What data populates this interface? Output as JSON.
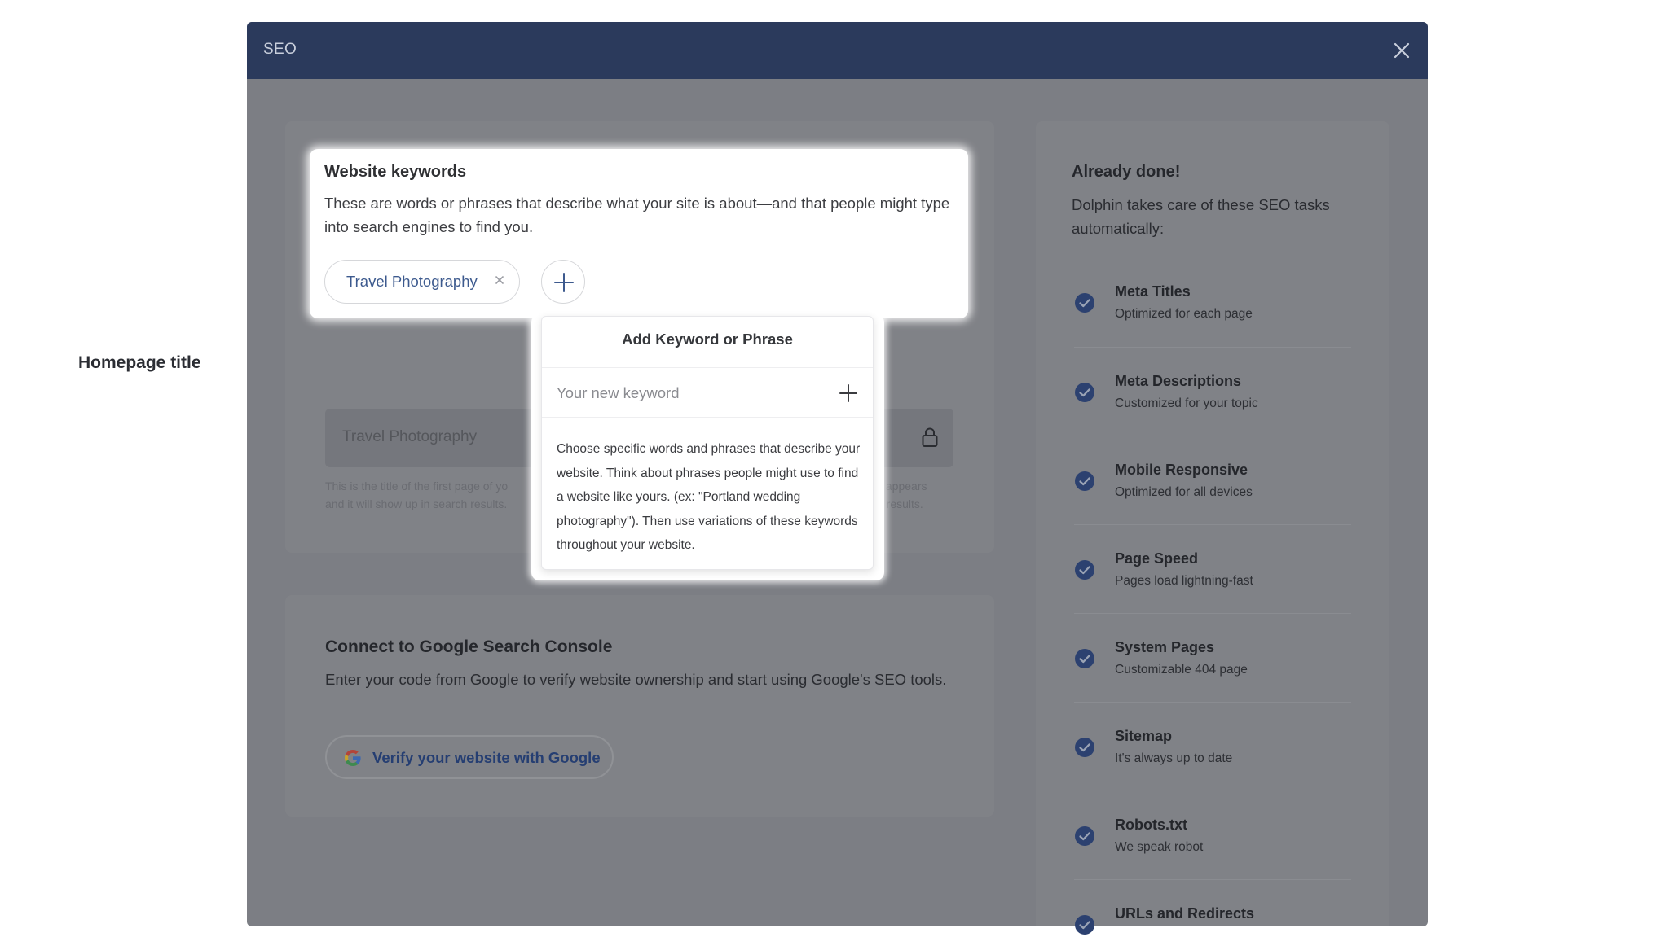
{
  "modal": {
    "title": "SEO"
  },
  "keywords": {
    "title": "Website keywords",
    "description": "These are words or phrases that describe what your site is about—and that people might type into search engines to find you.",
    "chips": [
      "Travel Photography"
    ]
  },
  "popover": {
    "title": "Add Keyword or Phrase",
    "input_placeholder": "Your new keyword",
    "help": "Choose specific words and phrases that describe your website. Think about phrases people might use to find a website like yours. (ex: \"Portland wedding photography\"). Then use variations of these keywords throughout your website."
  },
  "homepage": {
    "label": "Homepage title",
    "value": "Travel Photography",
    "help_left": "This is the title of the first page of yo",
    "help_left_2": "and it will show up in search results.",
    "help_right": "it appears",
    "help_right_2": "h results."
  },
  "gsc": {
    "title": "Connect to Google Search Console",
    "description": "Enter your code from Google to verify website ownership and start using Google's SEO tools.",
    "button_label": "Verify your website with Google"
  },
  "already_done": {
    "title": "Already done!",
    "description": "Dolphin takes care of these SEO tasks automatically:",
    "tasks": [
      {
        "name": "Meta Titles",
        "sub": "Optimized for each page"
      },
      {
        "name": "Meta Descriptions",
        "sub": "Customized for your topic"
      },
      {
        "name": "Mobile Responsive",
        "sub": "Optimized for all devices"
      },
      {
        "name": "Page Speed",
        "sub": "Pages load lightning-fast"
      },
      {
        "name": "System Pages",
        "sub": "Customizable 404 page"
      },
      {
        "name": "Sitemap",
        "sub": "It's always up to date"
      },
      {
        "name": "Robots.txt",
        "sub": "We speak robot"
      },
      {
        "name": "URLs and Redirects",
        "sub": ""
      }
    ]
  },
  "colors": {
    "header": "#2b3a5c",
    "accent": "#3d5a8e",
    "check": "#2c4170"
  }
}
